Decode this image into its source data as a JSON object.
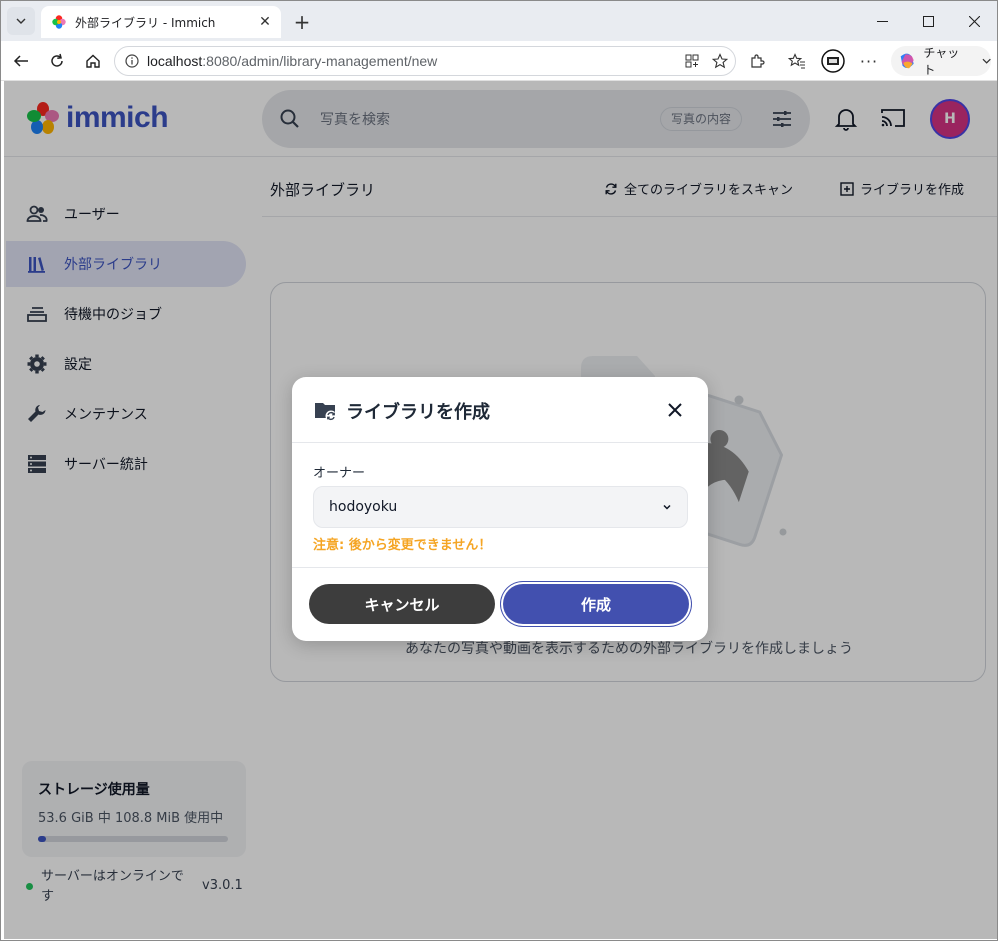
{
  "browser": {
    "tab_title": "外部ライブラリ - Immich",
    "url_host": "localhost",
    "url_rest": ":8080/admin/library-management/new",
    "chat_label": "チャット"
  },
  "app": {
    "logo_text": "immich",
    "search_placeholder": "写真を検索",
    "search_chip": "写真の内容",
    "avatar_initial": "H"
  },
  "sidebar": {
    "items": [
      {
        "label": "ユーザー",
        "icon": "users-icon"
      },
      {
        "label": "外部ライブラリ",
        "icon": "library-icon"
      },
      {
        "label": "待機中のジョブ",
        "icon": "jobs-icon"
      },
      {
        "label": "設定",
        "icon": "gear-icon"
      },
      {
        "label": "メンテナンス",
        "icon": "wrench-icon"
      },
      {
        "label": "サーバー統計",
        "icon": "server-icon"
      }
    ],
    "storage_title": "ストレージ使用量",
    "storage_text": "53.6 GiB 中 108.8 MiB 使用中",
    "storage_used_fraction": 0.002,
    "server_status": "サーバーはオンラインです",
    "version": "v3.0.1"
  },
  "main": {
    "title": "外部ライブラリ",
    "scan_all": "全てのライブラリをスキャン",
    "create_library": "ライブラリを作成",
    "empty_message": "あなたの写真や動画を表示するための外部ライブラリを作成しましょう"
  },
  "modal": {
    "title": "ライブラリを作成",
    "owner_label": "オーナー",
    "owner_value": "hodoyoku",
    "warning": "注意: 後から変更できません！",
    "cancel": "キャンセル",
    "create": "作成"
  },
  "colors": {
    "accent": "#4250af",
    "warning": "#f5a524",
    "online": "#22c55e"
  }
}
